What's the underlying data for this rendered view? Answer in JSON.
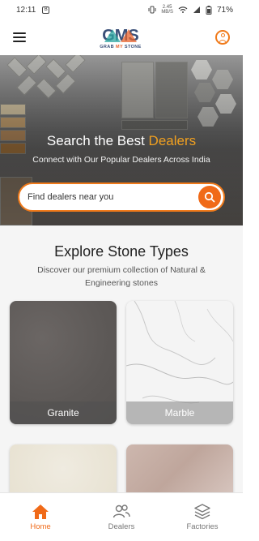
{
  "status_bar": {
    "time": "12:11",
    "network_speed_value": "2.45",
    "network_speed_unit": "MB/S",
    "battery": "71%"
  },
  "header": {
    "logo_initials": "GMS",
    "logo_text_grab": "GRAB",
    "logo_text_my": "MY",
    "logo_text_stone": "STONE"
  },
  "hero": {
    "title_prefix": "Search the Best ",
    "title_highlight": "Dealers",
    "subtitle": "Connect with Our Popular Dealers Across India",
    "search_placeholder": "Find dealers near you"
  },
  "explore": {
    "title": "Explore Stone Types",
    "description": "Discover our premium collection of Natural & Engineering stones",
    "cards": [
      {
        "label": "Granite"
      },
      {
        "label": "Marble"
      }
    ]
  },
  "bottom_nav": {
    "items": [
      {
        "label": "Home",
        "icon": "home-icon",
        "active": true
      },
      {
        "label": "Dealers",
        "icon": "users-icon",
        "active": false
      },
      {
        "label": "Factories",
        "icon": "layers-icon",
        "active": false
      }
    ]
  },
  "colors": {
    "accent": "#f06a18",
    "highlight": "#f0a020",
    "logo_blue": "#3a4f78"
  }
}
